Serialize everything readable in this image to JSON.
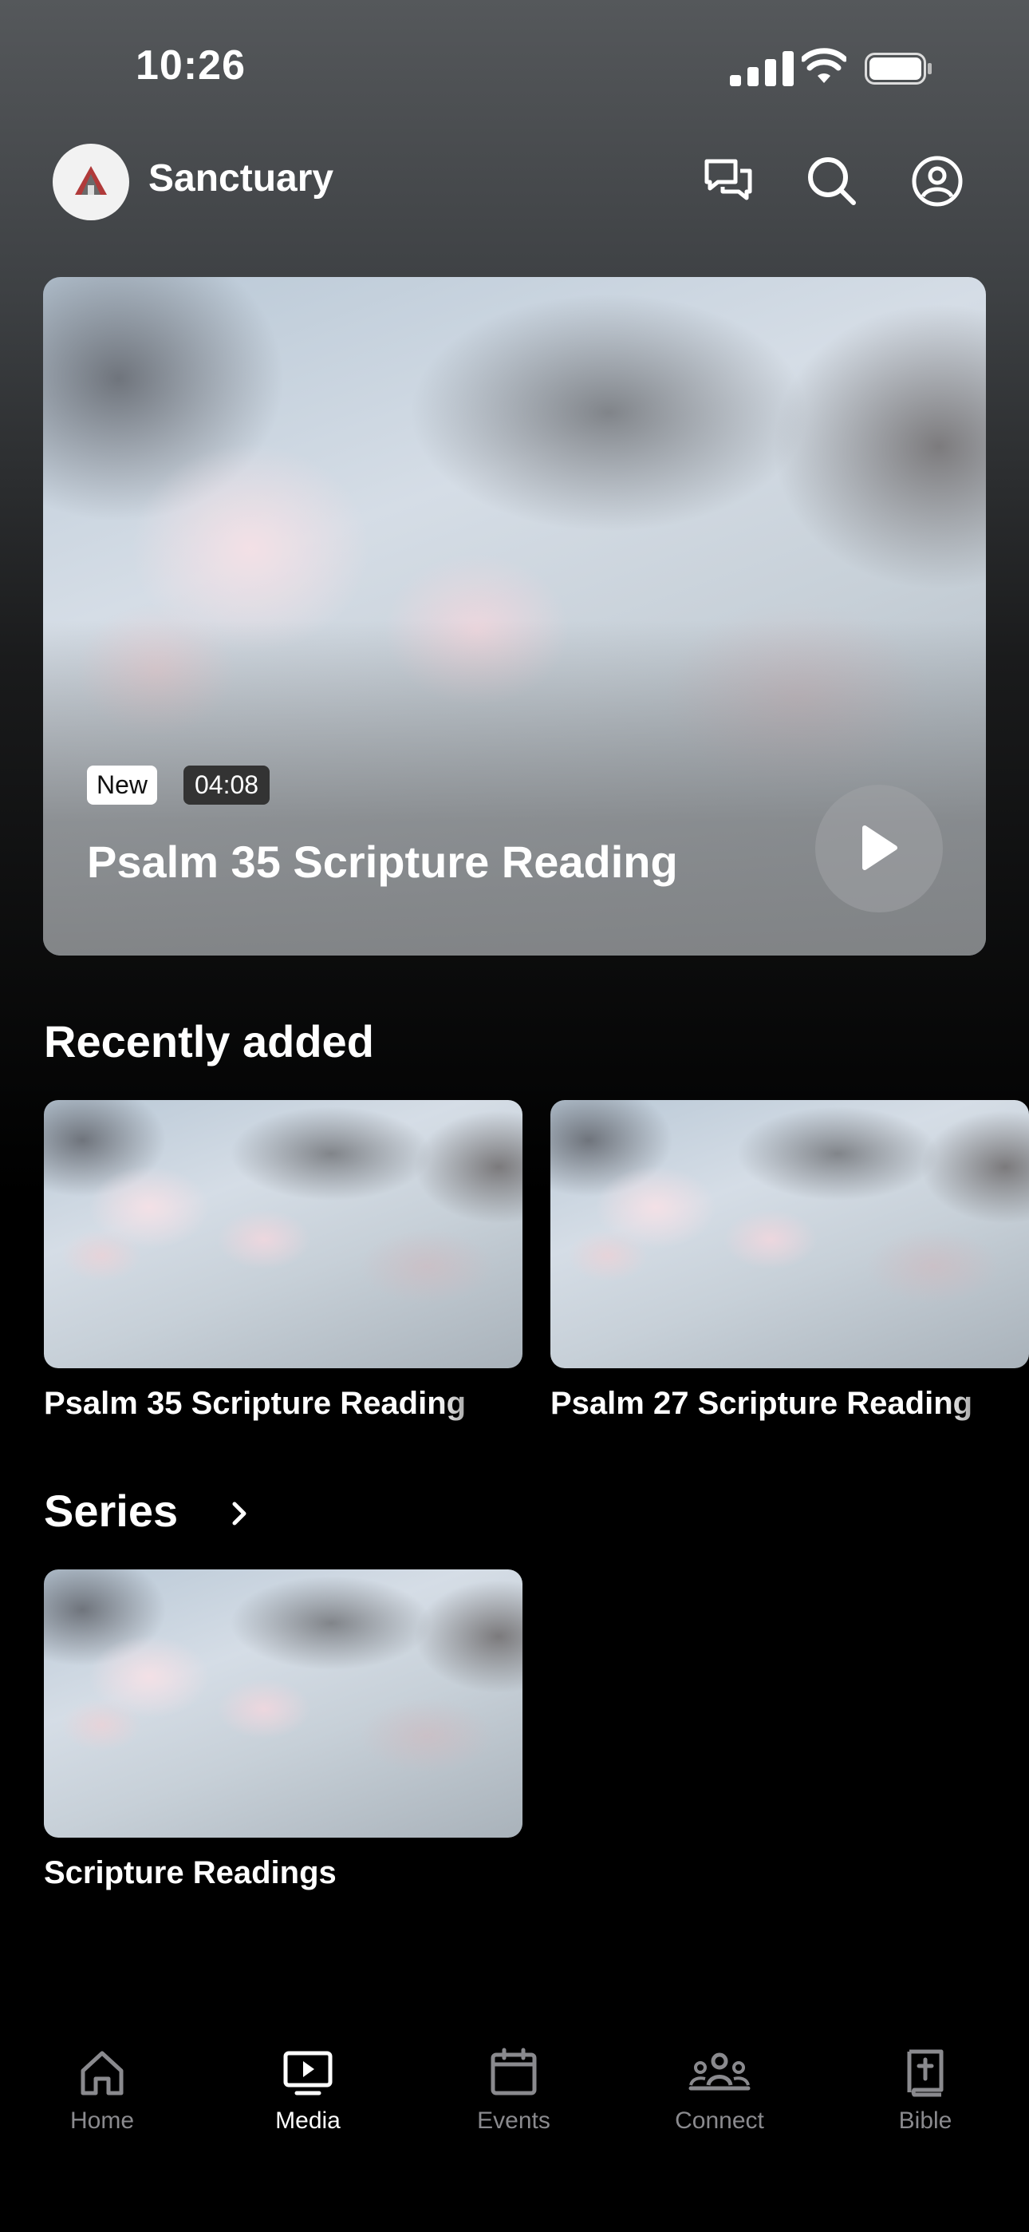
{
  "status_bar": {
    "time": "10:26"
  },
  "header": {
    "app_name": "Sanctuary",
    "icons": [
      "logo",
      "chat-icon",
      "search-icon",
      "account-icon"
    ]
  },
  "hero": {
    "badge": "New",
    "duration": "04:08",
    "title": "Psalm 35 Scripture Reading"
  },
  "recently_added": {
    "title": "Recently added",
    "items": [
      {
        "title": "Psalm 35 Scripture Reading"
      },
      {
        "title": "Psalm 27 Scripture Reading"
      }
    ]
  },
  "series": {
    "title": "Series",
    "items": [
      {
        "title": "Scripture Readings"
      }
    ]
  },
  "tabbar": {
    "active": "Media",
    "tabs": [
      {
        "label": "Home",
        "icon": "home-icon"
      },
      {
        "label": "Media",
        "icon": "media-icon"
      },
      {
        "label": "Events",
        "icon": "calendar-icon"
      },
      {
        "label": "Connect",
        "icon": "people-icon"
      },
      {
        "label": "Bible",
        "icon": "bible-icon"
      }
    ]
  },
  "colors": {
    "background": "#000000",
    "inactive_tab": "#8a8a8e",
    "active_tab": "#ffffff"
  }
}
